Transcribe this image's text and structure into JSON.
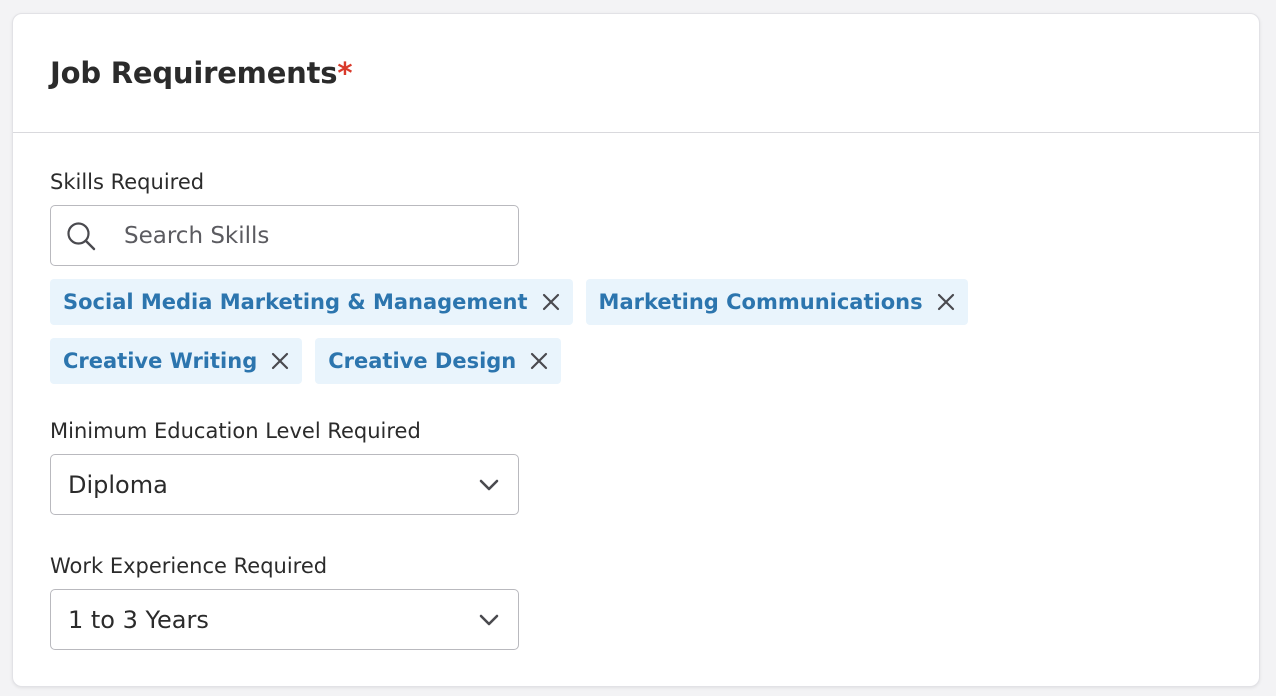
{
  "card": {
    "title": "Job Requirements",
    "required_marker": "*"
  },
  "skills": {
    "label": "Skills Required",
    "search_placeholder": "Search Skills",
    "chips": [
      "Social Media Marketing & Management",
      "Marketing Communications",
      "Creative Writing",
      "Creative Design"
    ]
  },
  "education": {
    "label": "Minimum Education Level Required",
    "selected": "Diploma"
  },
  "experience": {
    "label": "Work Experience Required",
    "selected": "1 to 3 Years"
  },
  "icons": {
    "search": "search-icon",
    "remove": "close-icon",
    "dropdown": "chevron-down-icon"
  },
  "colors": {
    "required": "#d93a2b",
    "chip_background": "#e9f4fc",
    "chip_text": "#2c75ae"
  }
}
